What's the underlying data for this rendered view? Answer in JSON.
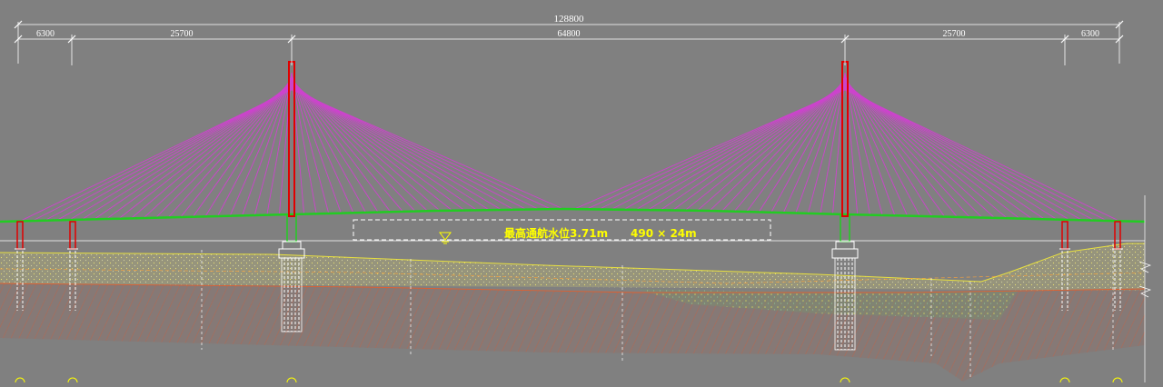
{
  "dimensions": {
    "total": "128800",
    "spans": [
      "6300",
      "25700",
      "64800",
      "25700",
      "6300"
    ]
  },
  "annotations": {
    "water_level": "最高通航水位3.71m",
    "clearance": "490 × 24m"
  },
  "colors": {
    "background": "#808080",
    "pylon": "#e00000",
    "cables": "#cc44cc",
    "deck": "#22cc22",
    "dimension_lines": "#ffffff",
    "pile": "#ffffff",
    "text_highlight": "#ffff00",
    "soil_fill_yellow": "#b4b070",
    "soil_fill_red": "#a07060",
    "water_line": "#ffffff"
  }
}
